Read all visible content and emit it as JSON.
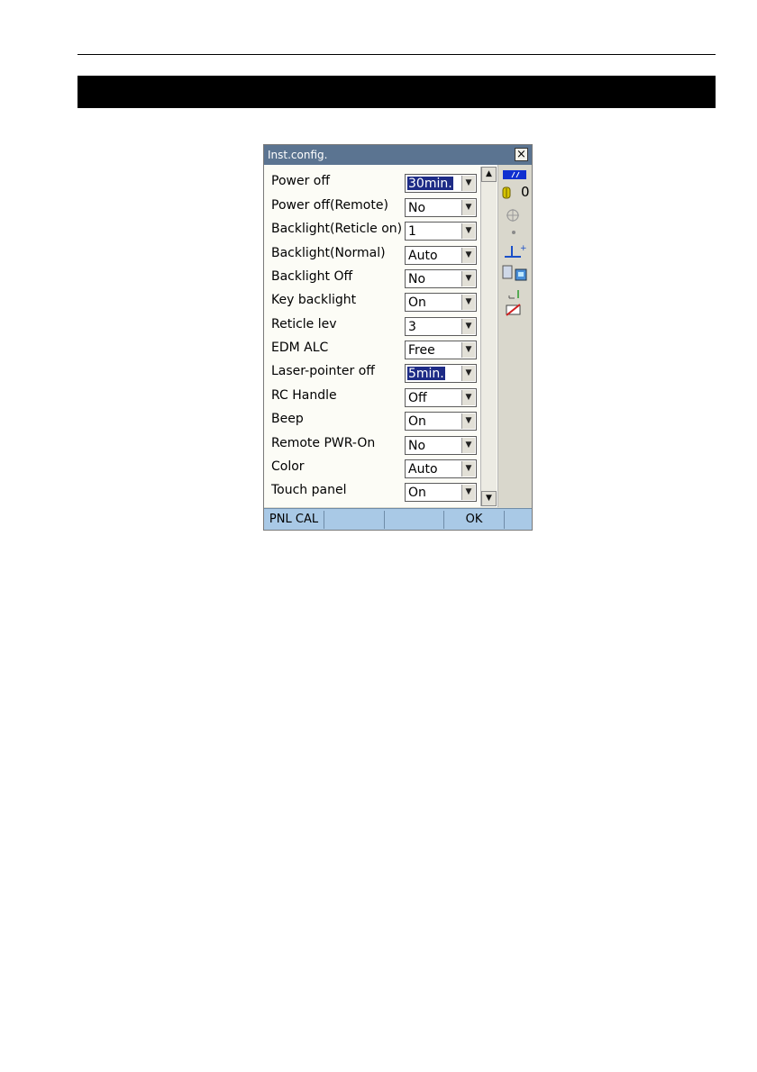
{
  "window": {
    "title": "Inst.config.",
    "close_symbol": "×"
  },
  "settings": [
    {
      "label": "Power off",
      "value": "30min.",
      "highlighted": true
    },
    {
      "label": "Power off(Remote)",
      "value": "No",
      "highlighted": false
    },
    {
      "label": "Backlight(Reticle on)",
      "value": "1",
      "highlighted": false
    },
    {
      "label": "Backlight(Normal)",
      "value": "Auto",
      "highlighted": false
    },
    {
      "label": "Backlight Off",
      "value": "No",
      "highlighted": false
    },
    {
      "label": "Key backlight",
      "value": "On",
      "highlighted": false
    },
    {
      "label": "Reticle lev",
      "value": "3",
      "highlighted": false
    },
    {
      "label": "EDM ALC",
      "value": "Free",
      "highlighted": false
    },
    {
      "label": "Laser-pointer off",
      "value": "5min.",
      "highlighted": true
    },
    {
      "label": "RC Handle",
      "value": "Off",
      "highlighted": false
    },
    {
      "label": "Beep",
      "value": "On",
      "highlighted": false
    },
    {
      "label": "Remote PWR-On",
      "value": "No",
      "highlighted": false
    },
    {
      "label": "Color",
      "value": "Auto",
      "highlighted": false
    },
    {
      "label": "Touch panel",
      "value": "On",
      "highlighted": false
    }
  ],
  "status": {
    "prism_constant": "0",
    "icons": [
      "battery-icon",
      "prism-icon",
      "tilt-crosshair-icon",
      "dot-icon",
      "target-icon",
      "communication-icon",
      "level-icon",
      "laser-off-icon"
    ]
  },
  "softkeys": [
    "PNL CAL",
    "",
    "",
    "OK",
    ""
  ],
  "colors": {
    "titlebar": "#5b7491",
    "softkey_bar": "#a9c9e6",
    "highlight": "#1d2b86",
    "section_bar": "#000000"
  }
}
